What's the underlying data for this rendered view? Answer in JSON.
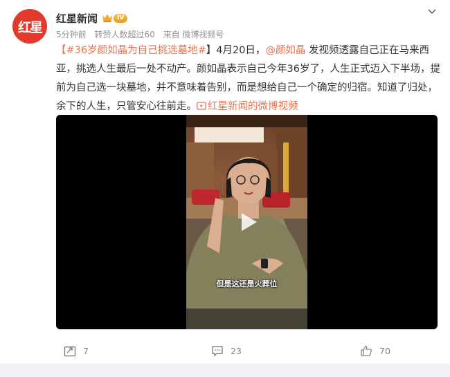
{
  "post": {
    "avatar_text": "红星",
    "author": "红星新闻",
    "vip_level": "IV",
    "time": "5分钟前",
    "reposts_note": "转赞人数超过60",
    "source": "来自 微博视频号",
    "topic": "#36岁颜如晶为自己挑选墓地#",
    "bracket_open": "【",
    "bracket_close": "】",
    "date_text": "4月20日，",
    "mention": "@颜如晶",
    "body": " 发视频透露自己正在马来西亚，挑选人生最后一处不动产。颜如晶表示自己今年36岁了，人生正式迈入下半场，提前为自己选一块墓地，并不意味着告别，而是想给自己一个确定的归宿。知道了归处，余下的人生，只管安心往前走。",
    "video_link": "红星新闻的微博视频"
  },
  "video": {
    "subtitle": "但是这还是火葬位"
  },
  "actions": {
    "repost_count": "7",
    "comment_count": "23",
    "like_count": "70"
  },
  "colors": {
    "accent": "#eb7350",
    "avatar_bg": "#e23b2e"
  }
}
